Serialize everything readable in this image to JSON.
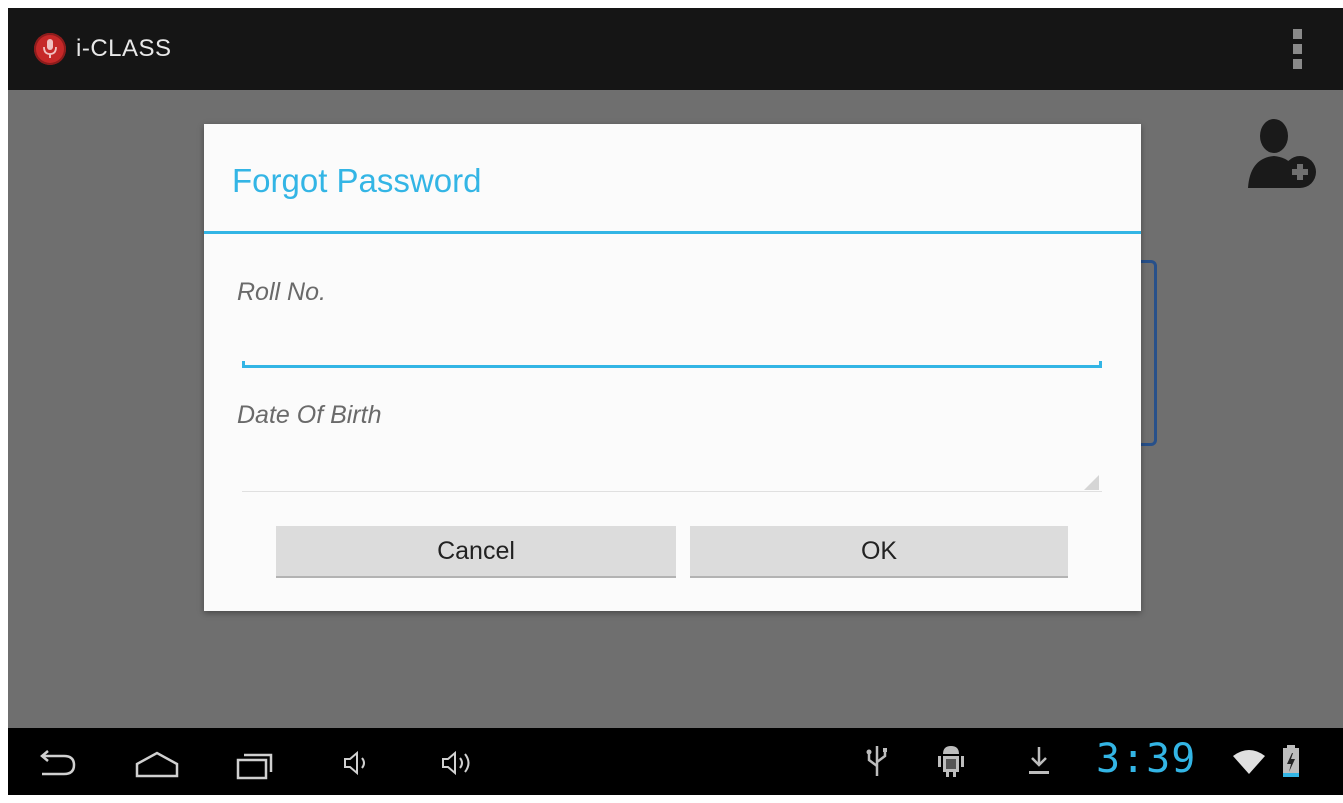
{
  "app": {
    "title": "i-CLASS"
  },
  "dialog": {
    "title": "Forgot Password",
    "roll_label": "Roll No.",
    "roll_value": "",
    "dob_label": "Date Of Birth",
    "dob_value": "",
    "cancel_label": "Cancel",
    "ok_label": "OK"
  },
  "status_bar": {
    "time": "3:39"
  },
  "icons": {
    "app": "microphone-icon",
    "overflow": "overflow-menu-icon",
    "add_user": "add-user-icon",
    "back": "back-icon",
    "home": "home-icon",
    "recents": "recent-apps-icon",
    "volume_down": "volume-down-icon",
    "volume_up": "volume-up-icon",
    "usb": "usb-icon",
    "debug": "android-debug-icon",
    "download": "download-icon",
    "wifi": "wifi-icon",
    "battery": "battery-charging-icon"
  },
  "colors": {
    "accent": "#33b5e5",
    "action_bar": "#151515",
    "nav_bar": "#000000",
    "dialog_bg": "#fbfbfb",
    "button_bg": "#dcdcdc"
  }
}
